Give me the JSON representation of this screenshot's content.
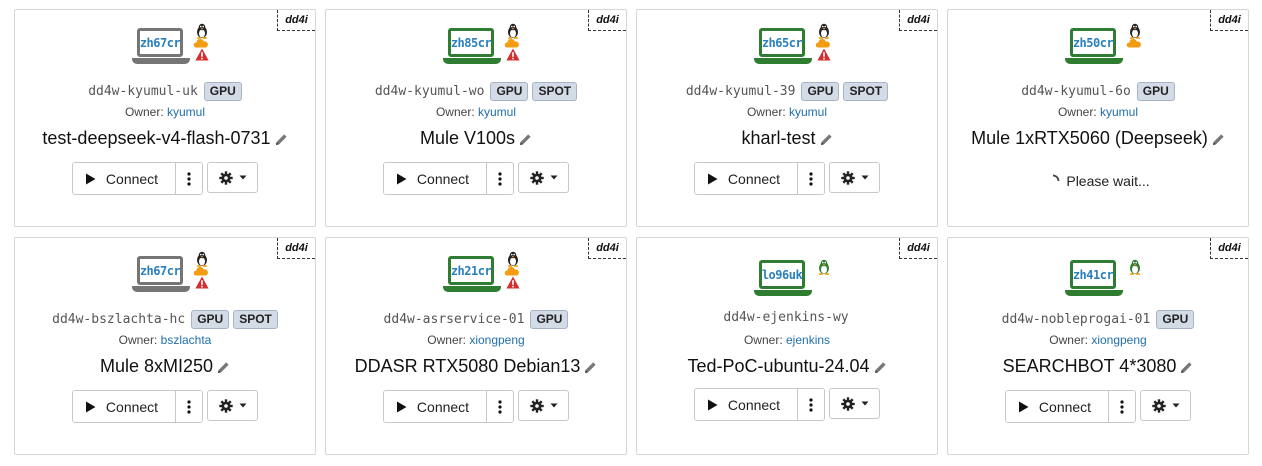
{
  "cards": [
    {
      "tag": "dd4i",
      "code": "zh67cr",
      "laptop": "gray",
      "warn": true,
      "cloud": true,
      "host": "dd4w-kyumul-uk",
      "badges": [
        "GPU"
      ],
      "owner_label": "Owner:",
      "owner": "kyumul",
      "title": "test-deepseek-v4-flash-0731",
      "state": "ready",
      "connect": "Connect"
    },
    {
      "tag": "dd4i",
      "code": "zh85cr",
      "laptop": "green",
      "warn": true,
      "cloud": true,
      "host": "dd4w-kyumul-wo",
      "badges": [
        "GPU",
        "SPOT"
      ],
      "owner_label": "Owner:",
      "owner": "kyumul",
      "title": "Mule V100s",
      "state": "ready",
      "connect": "Connect"
    },
    {
      "tag": "dd4i",
      "code": "zh65cr",
      "laptop": "green",
      "warn": true,
      "cloud": true,
      "host": "dd4w-kyumul-39",
      "badges": [
        "GPU",
        "SPOT"
      ],
      "owner_label": "Owner:",
      "owner": "kyumul",
      "title": "kharl-test",
      "state": "ready",
      "connect": "Connect"
    },
    {
      "tag": "dd4i",
      "code": "zh50cr",
      "laptop": "green",
      "warn": false,
      "cloud": true,
      "host": "dd4w-kyumul-6o",
      "badges": [
        "GPU"
      ],
      "owner_label": "Owner:",
      "owner": "kyumul",
      "title": "Mule 1xRTX5060 (Deepseek)",
      "state": "wait",
      "wait_text": "Please wait..."
    },
    {
      "tag": "dd4i",
      "code": "zh67cr",
      "laptop": "gray",
      "warn": true,
      "cloud": true,
      "host": "dd4w-bszlachta-hc",
      "badges": [
        "GPU",
        "SPOT"
      ],
      "owner_label": "Owner:",
      "owner": "bszlachta",
      "title": "Mule 8xMI250",
      "state": "ready",
      "connect": "Connect"
    },
    {
      "tag": "dd4i",
      "code": "zh21cr",
      "laptop": "green",
      "warn": true,
      "cloud": true,
      "host": "dd4w-asrservice-01",
      "badges": [
        "GPU"
      ],
      "owner_label": "Owner:",
      "owner": "xiongpeng",
      "title": "DDASR RTX5080 Debian13",
      "state": "ready",
      "connect": "Connect"
    },
    {
      "tag": "dd4i",
      "code": "lo96uk",
      "laptop": "green",
      "warn": false,
      "cloud": false,
      "greenlinux": true,
      "host": "dd4w-ejenkins-wy",
      "badges": [],
      "owner_label": "Owner:",
      "owner": "ejenkins",
      "title": "Ted-PoC-ubuntu-24.04",
      "state": "ready",
      "connect": "Connect"
    },
    {
      "tag": "dd4i",
      "code": "zh41cr",
      "laptop": "green",
      "warn": false,
      "cloud": false,
      "greenlinux": true,
      "host": "dd4w-nobleprogai-01",
      "badges": [
        "GPU"
      ],
      "owner_label": "Owner:",
      "owner": "xiongpeng",
      "title": "SEARCHBOT 4*3080",
      "state": "ready",
      "connect": "Connect"
    }
  ],
  "colors": {
    "laptop_gray": "#757575",
    "laptop_green": "#2e7d32",
    "link": "#1f6faa",
    "code": "#2a7fbf",
    "badge_bg": "#d3dbe6",
    "warn": "#d32f2f",
    "cloud": "#f39c12"
  }
}
